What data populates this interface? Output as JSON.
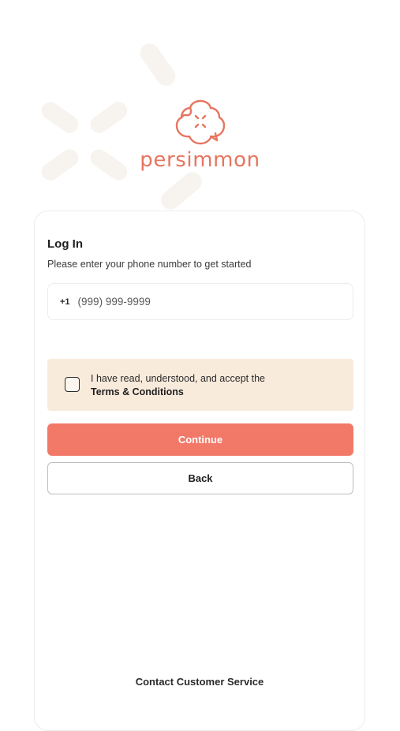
{
  "brand": {
    "name": "persimmon",
    "accent_color": "#e77560",
    "logo_icon": "persimmon-flower-icon"
  },
  "login": {
    "title": "Log In",
    "subtitle": "Please enter your phone number to get started",
    "country_code": "+1",
    "phone_placeholder": "(999) 999-9999",
    "phone_value": ""
  },
  "terms": {
    "text": "I have read, understood, and accept the",
    "link_label": "Terms & Conditions",
    "checked": false,
    "background_color": "#f9ebdc"
  },
  "actions": {
    "continue_label": "Continue",
    "continue_color": "#f27868",
    "back_label": "Back"
  },
  "footer": {
    "contact_label": "Contact Customer Service"
  }
}
